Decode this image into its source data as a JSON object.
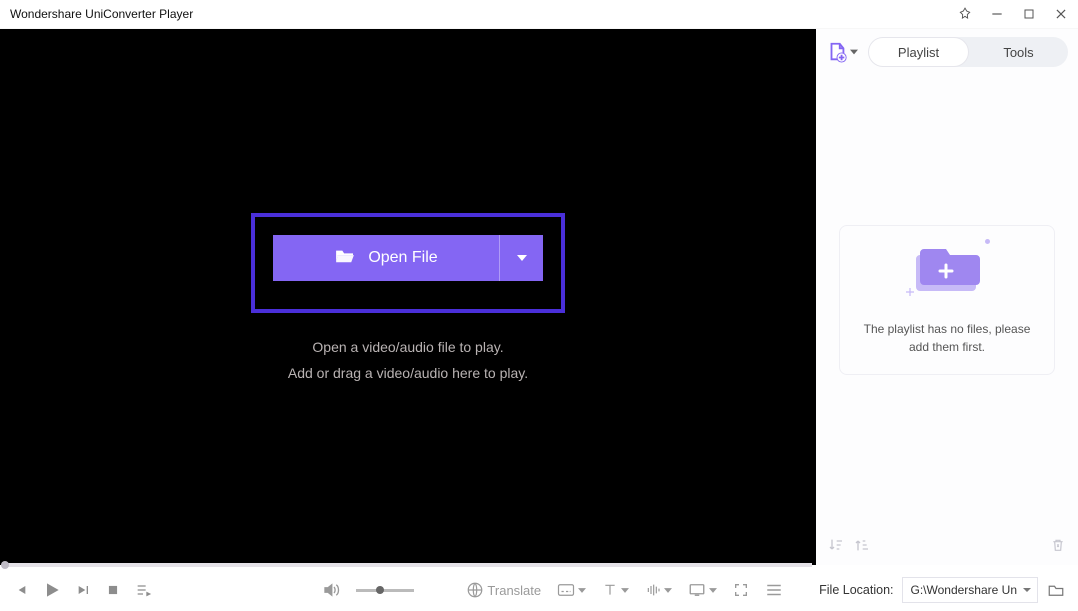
{
  "title": "Wondershare UniConverter Player",
  "open_button": {
    "label": "Open File",
    "hint1": "Open a video/audio file to play.",
    "hint2": "Add or drag a video/audio here to play."
  },
  "side": {
    "tabs": {
      "playlist": "Playlist",
      "tools": "Tools"
    },
    "empty_text": "The playlist has no files, please add them first."
  },
  "controls": {
    "translate": "Translate"
  },
  "footer": {
    "loc_label": "File Location:",
    "loc_value": "G:\\Wondershare Un"
  }
}
